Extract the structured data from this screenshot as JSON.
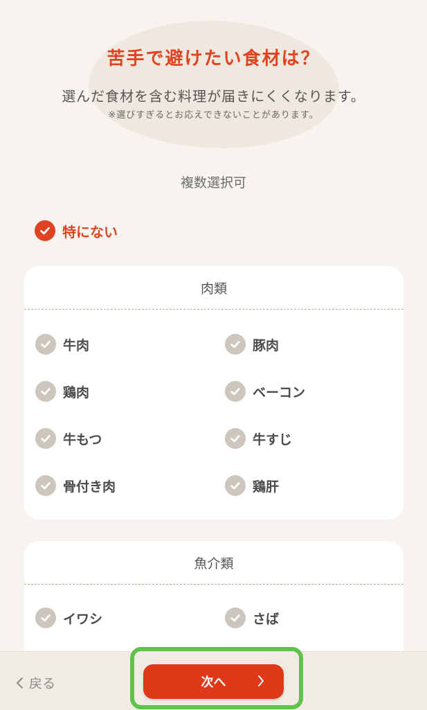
{
  "header": {
    "title": "苦手で避けたい食材は？",
    "subtitle": "選んだ食材を含む料理が届きにくくなります。",
    "note": "※選びすぎるとお応えできないことがあります。"
  },
  "multi_select_label": "複数選択可",
  "none_option": {
    "label": "特にない",
    "checked": true
  },
  "categories": [
    {
      "title": "肉類",
      "items": [
        {
          "label": "牛肉",
          "checked": false
        },
        {
          "label": "豚肉",
          "checked": false
        },
        {
          "label": "鶏肉",
          "checked": false
        },
        {
          "label": "ベーコン",
          "checked": false
        },
        {
          "label": "牛もつ",
          "checked": false
        },
        {
          "label": "牛すじ",
          "checked": false
        },
        {
          "label": "骨付き肉",
          "checked": false
        },
        {
          "label": "鶏肝",
          "checked": false
        }
      ]
    },
    {
      "title": "魚介類",
      "items": [
        {
          "label": "イワシ",
          "checked": false
        },
        {
          "label": "さば",
          "checked": false
        }
      ]
    }
  ],
  "footer": {
    "back_label": "戻る",
    "next_label": "次へ"
  },
  "colors": {
    "accent": "#e04322",
    "unchecked": "#cdc6bd",
    "highlight": "#5ec24b"
  },
  "icons": {
    "check": "check-icon",
    "back": "chevron-left-icon",
    "next": "chevron-right-icon"
  }
}
